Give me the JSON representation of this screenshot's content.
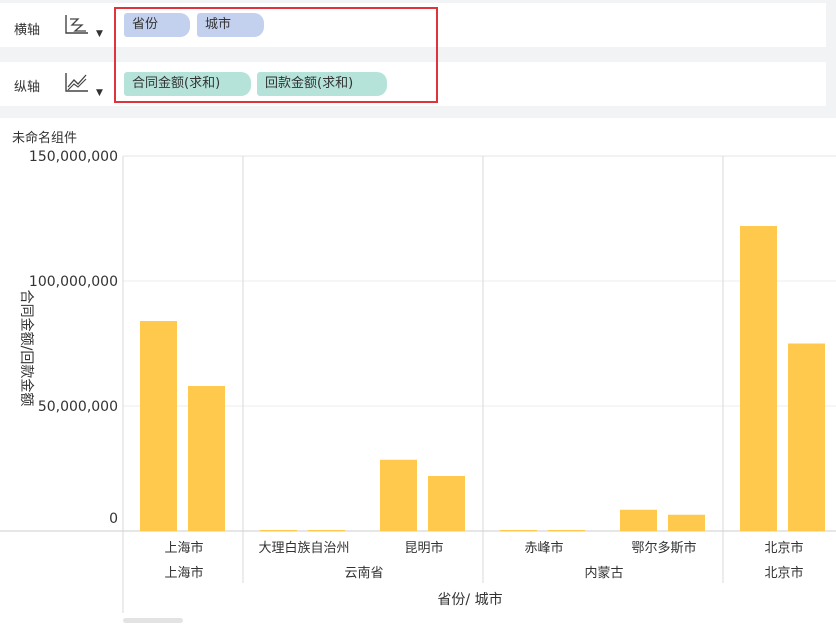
{
  "toolbar": {
    "x_axis": {
      "label": "横轴",
      "icon": "column-chart-icon",
      "fields": [
        "省份",
        "城市"
      ]
    },
    "y_axis": {
      "label": "纵轴",
      "icon": "line-chart-icon",
      "fields": [
        "合同金额(求和)",
        "回款金额(求和)"
      ]
    }
  },
  "widget_title": "未命名组件",
  "colors": {
    "bar": "#ffc94d",
    "highlight": "#e0343d",
    "chip_x": "#c3d1ef",
    "chip_y": "#b5e3da"
  },
  "chart_data": {
    "type": "bar",
    "xlabel": "省份/ 城市",
    "ylabel": "合同金额/回款金额",
    "ylim": [
      0,
      150000000
    ],
    "yticks": [
      "0",
      "50,000,000",
      "100,000,000",
      "150,000,000"
    ],
    "ytick_values": [
      0,
      50000000,
      100000000,
      150000000
    ],
    "groups": [
      {
        "name": "上海市",
        "cities": [
          {
            "name": "上海市",
            "values": [
              84000000,
              58000000
            ]
          }
        ]
      },
      {
        "name": "云南省",
        "cities": [
          {
            "name": "大理白族自治州",
            "values": [
              400000,
              300000
            ]
          },
          {
            "name": "昆明市",
            "values": [
              28500000,
              22000000
            ]
          }
        ]
      },
      {
        "name": "内蒙古",
        "cities": [
          {
            "name": "赤峰市",
            "values": [
              300000,
              200000
            ]
          },
          {
            "name": "鄂尔多斯市",
            "values": [
              8500000,
              6500000
            ]
          }
        ]
      },
      {
        "name": "北京市",
        "cities": [
          {
            "name": "北京市",
            "values": [
              122000000,
              75000000
            ]
          }
        ]
      }
    ]
  }
}
